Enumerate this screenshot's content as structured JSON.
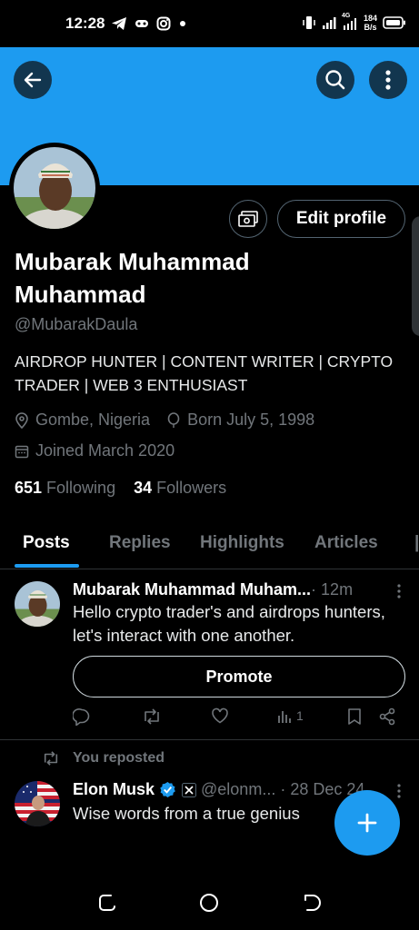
{
  "status_bar": {
    "time": "12:28",
    "left_icons": [
      "telegram-icon",
      "gamepad-icon",
      "instagram-icon",
      "dot-icon"
    ],
    "net_speed_value": "184",
    "net_speed_unit": "B/s",
    "network_labels": [
      "4G",
      "4G"
    ]
  },
  "header": {
    "back_icon": "arrow-left-icon",
    "search_icon": "search-icon",
    "more_icon": "more-vertical-icon",
    "banner_color": "#1d9bf0"
  },
  "profile": {
    "name": "Mubarak Muhammad Muhammad",
    "handle": "@MubarakDaula",
    "bio": "AIRDROP HUNTER | CONTENT WRITER | CRYPTO TRADER | WEB 3 ENTHUSIAST",
    "location": "Gombe, Nigeria",
    "born": "Born July 5, 1998",
    "joined": "Joined March 2020",
    "following_count": "651",
    "following_label": "Following",
    "followers_count": "34",
    "followers_label": "Followers",
    "edit_label": "Edit profile"
  },
  "tabs": [
    {
      "label": "Posts",
      "active": true
    },
    {
      "label": "Replies"
    },
    {
      "label": "Highlights"
    },
    {
      "label": "Articles"
    }
  ],
  "posts": [
    {
      "author": "Mubarak Muhammad Muham...",
      "time": " · 12m",
      "text": "Hello crypto trader's and airdrops hunters, let's interact with one another.",
      "promote_label": "Promote",
      "views": "1"
    },
    {
      "repost_label": "You reposted",
      "author": "Elon Musk",
      "handle_time": "@elonm... · 28 Dec 24",
      "text": "Wise words from a true genius"
    }
  ],
  "colors": {
    "accent": "#1d9bf0",
    "background": "#000000",
    "muted_text": "#71767b",
    "border": "#2f3336"
  }
}
